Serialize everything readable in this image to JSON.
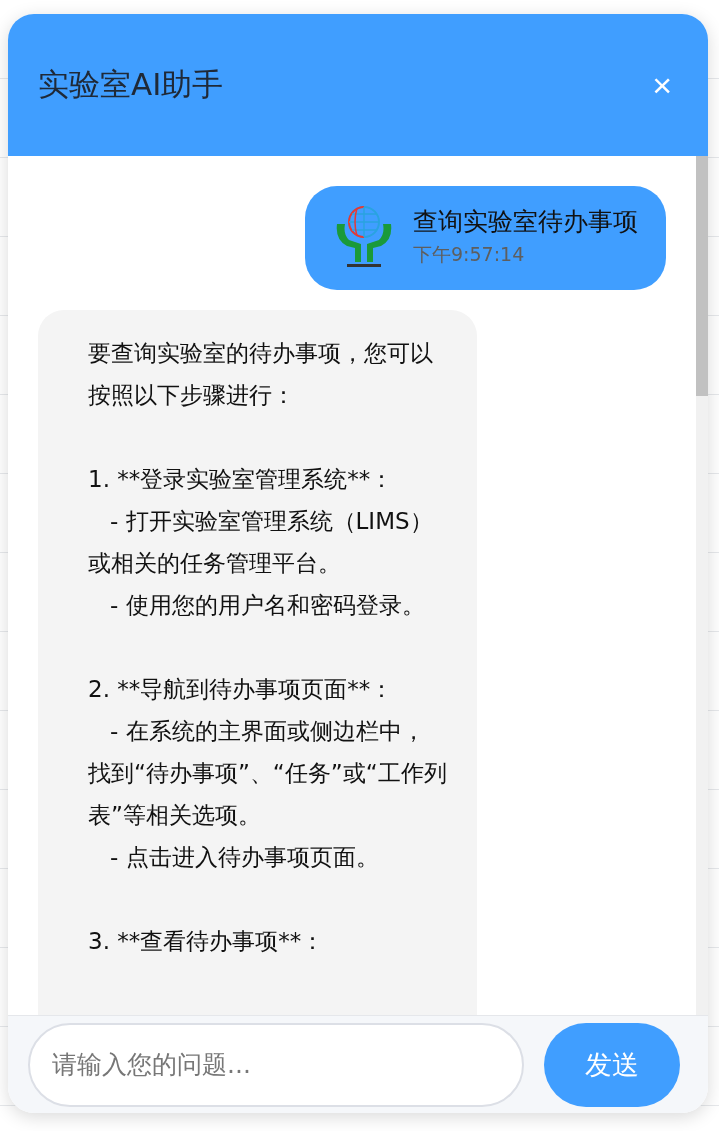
{
  "window": {
    "title": "实验室AI助手",
    "close": "×"
  },
  "messages": [
    {
      "kind": "user",
      "text": "查询实验室待办事项",
      "time": "下午9:57:14"
    },
    {
      "kind": "bot",
      "blocks": [
        [
          "要查询实验室的待办事项，您可以",
          "按照以下步骤进行："
        ],
        [
          "1. **登录实验室管理系统**：",
          "   - 打开实验室管理系统（LIMS）",
          "或相关的任务管理平台。",
          "   - 使用您的用户名和密码登录。"
        ],
        [
          "2. **导航到待办事项页面**：",
          "   - 在系统的主界面或侧边栏中，",
          "找到“待办事项”、“任务”或“工作列",
          "表”等相关选项。",
          "   - 点击进入待办事项页面。"
        ],
        [
          "3. **查看待办事项**："
        ]
      ]
    }
  ],
  "input": {
    "placeholder": "请输入您的问题..."
  },
  "send_button": "发送"
}
